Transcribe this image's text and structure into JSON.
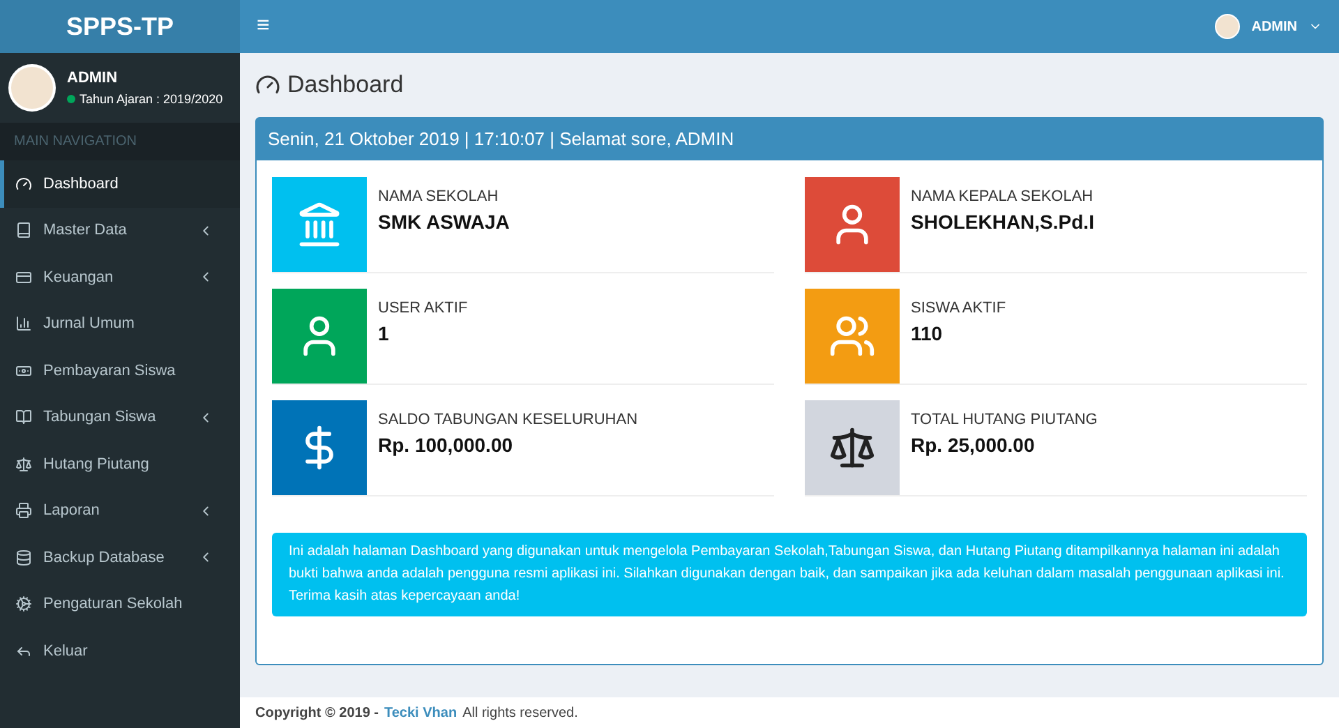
{
  "brand": "SPPS-TP",
  "header": {
    "menu_glyph": "≡",
    "user": "ADMIN"
  },
  "user_panel": {
    "name": "ADMIN",
    "status": "Tahun Ajaran : 2019/2020",
    "online": true
  },
  "nav_header": "MAIN NAVIGATION",
  "sidebar": {
    "items": [
      {
        "label": "Dashboard",
        "selected": true,
        "has_submenu": false
      },
      {
        "label": "Master Data",
        "selected": false,
        "has_submenu": true
      },
      {
        "label": "Keuangan",
        "selected": false,
        "has_submenu": true
      },
      {
        "label": "Jurnal Umum",
        "selected": false,
        "has_submenu": false
      },
      {
        "label": "Pembayaran Siswa",
        "selected": false,
        "has_submenu": false
      },
      {
        "label": "Tabungan Siswa",
        "selected": false,
        "has_submenu": true
      },
      {
        "label": "Hutang Piutang",
        "selected": false,
        "has_submenu": false
      },
      {
        "label": "Laporan",
        "selected": false,
        "has_submenu": true
      },
      {
        "label": "Backup Database",
        "selected": false,
        "has_submenu": true
      },
      {
        "label": "Pengaturan Sekolah",
        "selected": false,
        "has_submenu": false
      },
      {
        "label": "Keluar",
        "selected": false,
        "has_submenu": false
      }
    ]
  },
  "page_title": "Dashboard",
  "box_header": "Senin, 21 Oktober 2019 | 17:10:07 | Selamat sore, ADMIN",
  "stats": [
    {
      "label": "NAMA SEKOLAH",
      "value": "SMK ASWAJA",
      "color": "#00c0ef"
    },
    {
      "label": "NAMA KEPALA SEKOLAH",
      "value": "SHOLEKHAN,S.Pd.I",
      "color": "#dd4b39"
    },
    {
      "label": "USER AKTIF",
      "value": "1",
      "color": "#00a65a"
    },
    {
      "label": "SISWA AKTIF",
      "value": "110",
      "color": "#f39c12"
    },
    {
      "label": "SALDO TABUNGAN KESELURUHAN",
      "value": "Rp. 100,000.00",
      "color": "#0073b7"
    },
    {
      "label": "TOTAL HUTANG PIUTANG",
      "value": "Rp. 25,000.00",
      "color": "#d2d6de"
    }
  ],
  "callout": "Ini adalah halaman Dashboard yang digunakan untuk mengelola Pembayaran Sekolah,Tabungan Siswa, dan Hutang Piutang ditampilkannya halaman ini adalah bukti bahwa anda adalah pengguna resmi aplikasi ini. Silahkan digunakan dengan baik, dan sampaikan jika ada keluhan dalam masalah penggunaan aplikasi ini. Terima kasih atas kepercayaan anda!",
  "footer": {
    "prefix": "Copyright © 2019 -",
    "link": "Tecki Vhan",
    "suffix": "All rights reserved."
  }
}
